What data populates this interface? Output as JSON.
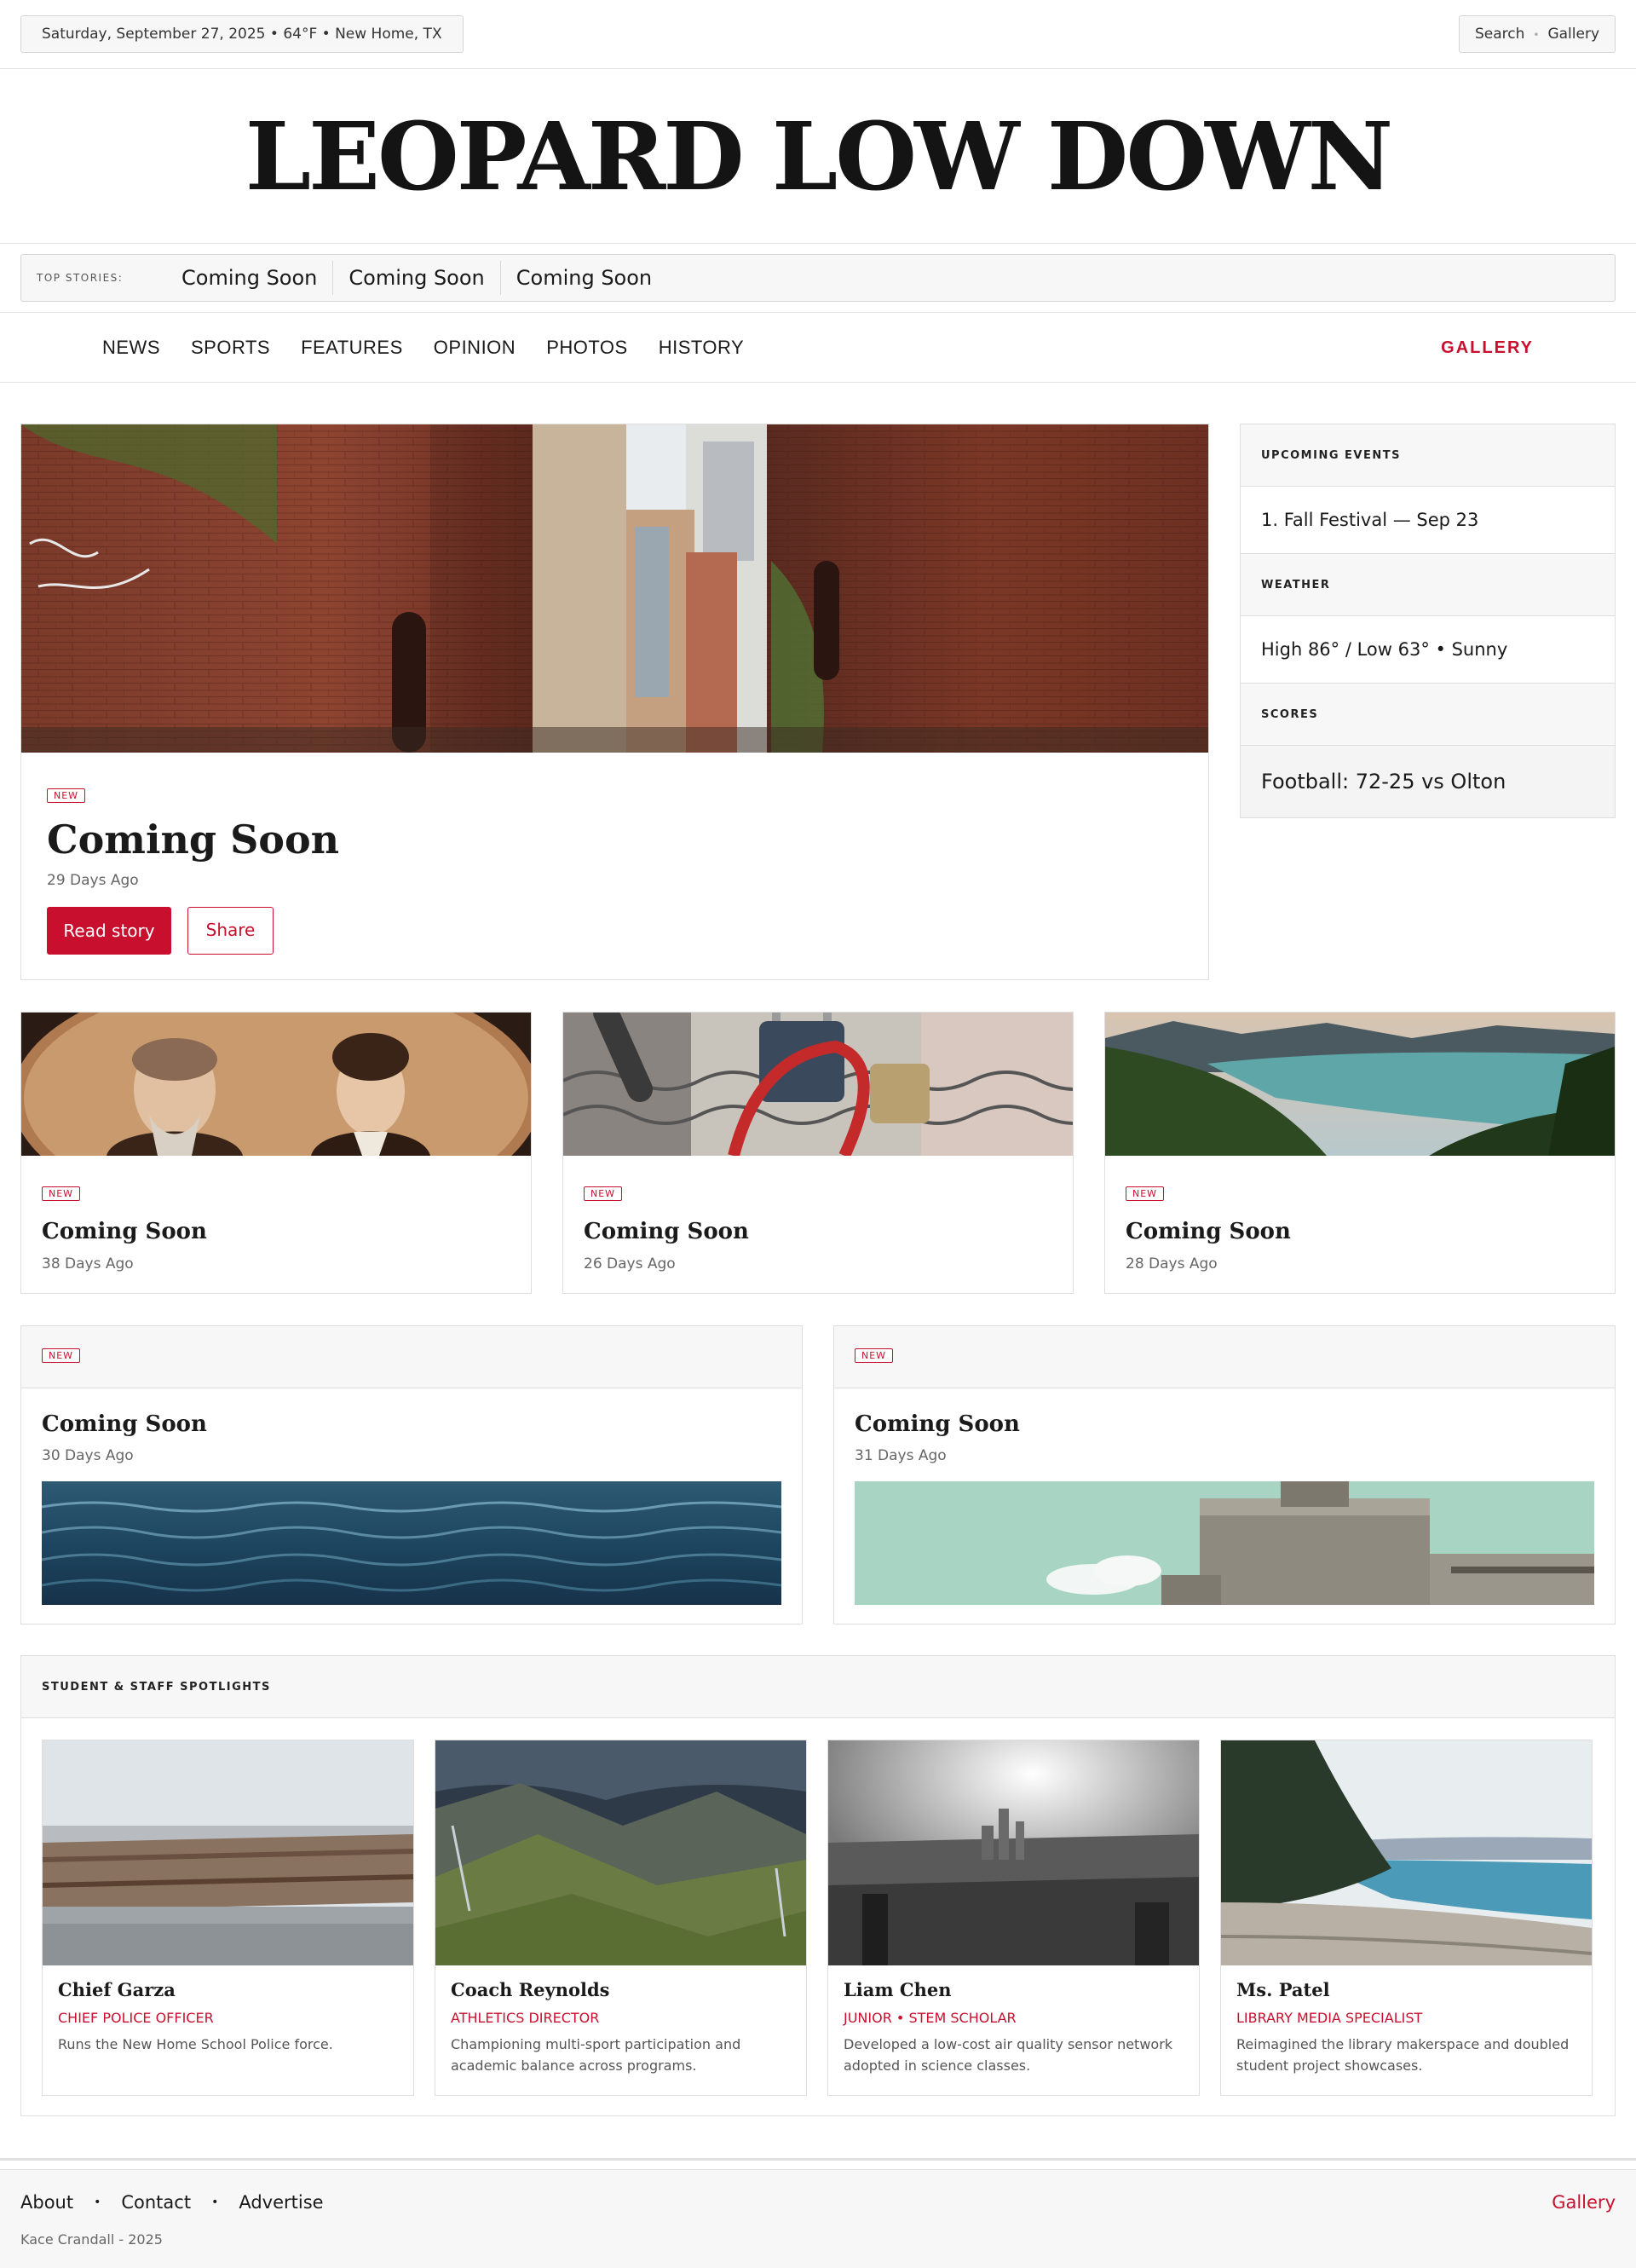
{
  "topbar": {
    "dateline": "Saturday, September 27, 2025 • 64°F • New Home, TX",
    "search": "Search",
    "gallery": "Gallery",
    "sep": "•"
  },
  "masthead": {
    "title": "LEOPARD LOW DOWN"
  },
  "ticker": {
    "label": "TOP STORIES:",
    "items": [
      "Coming Soon",
      "Coming Soon",
      "Coming Soon"
    ]
  },
  "nav": {
    "items": [
      "NEWS",
      "SPORTS",
      "FEATURES",
      "OPINION",
      "PHOTOS",
      "HISTORY"
    ],
    "gallery": "GALLERY"
  },
  "hero": {
    "badge": "NEW",
    "title": "Coming Soon",
    "ago": "29 Days Ago",
    "read": "Read story",
    "share": "Share"
  },
  "sidebar": {
    "events_header": "UPCOMING EVENTS",
    "events_item": "1. Fall Festival — Sep 23",
    "weather_header": "WEATHER",
    "weather_item": "High 86° / Low 63° • Sunny",
    "scores_header": "SCORES",
    "scores_item": "Football: 72-25 vs Olton"
  },
  "cards": [
    {
      "badge": "NEW",
      "title": "Coming Soon",
      "ago": "38 Days Ago"
    },
    {
      "badge": "NEW",
      "title": "Coming Soon",
      "ago": "26 Days Ago"
    },
    {
      "badge": "NEW",
      "title": "Coming Soon",
      "ago": "28 Days Ago"
    }
  ],
  "wide_cards": [
    {
      "badge": "NEW",
      "title": "Coming Soon",
      "ago": "30 Days Ago"
    },
    {
      "badge": "NEW",
      "title": "Coming Soon",
      "ago": "31 Days Ago"
    }
  ],
  "spotlights": {
    "header": "STUDENT & STAFF SPOTLIGHTS",
    "people": [
      {
        "name": "Chief Garza",
        "role": "CHIEF POLICE OFFICER",
        "desc": "Runs the New Home School Police force."
      },
      {
        "name": "Coach Reynolds",
        "role": "ATHLETICS DIRECTOR",
        "desc": "Championing multi-sport participation and academic balance across programs."
      },
      {
        "name": "Liam Chen",
        "role": "JUNIOR • STEM SCHOLAR",
        "desc": "Developed a low-cost air quality sensor network adopted in science classes."
      },
      {
        "name": "Ms. Patel",
        "role": "LIBRARY MEDIA SPECIALIST",
        "desc": "Reimagined the library makerspace and doubled student project showcases."
      }
    ]
  },
  "footer": {
    "links": [
      "About",
      "Contact",
      "Advertise"
    ],
    "dot": "•",
    "gallery": "Gallery",
    "copy": "Kace Crandall - 2025"
  },
  "colors": {
    "accent": "#c8102e",
    "border": "#dedede",
    "panel": "#f7f7f7"
  }
}
